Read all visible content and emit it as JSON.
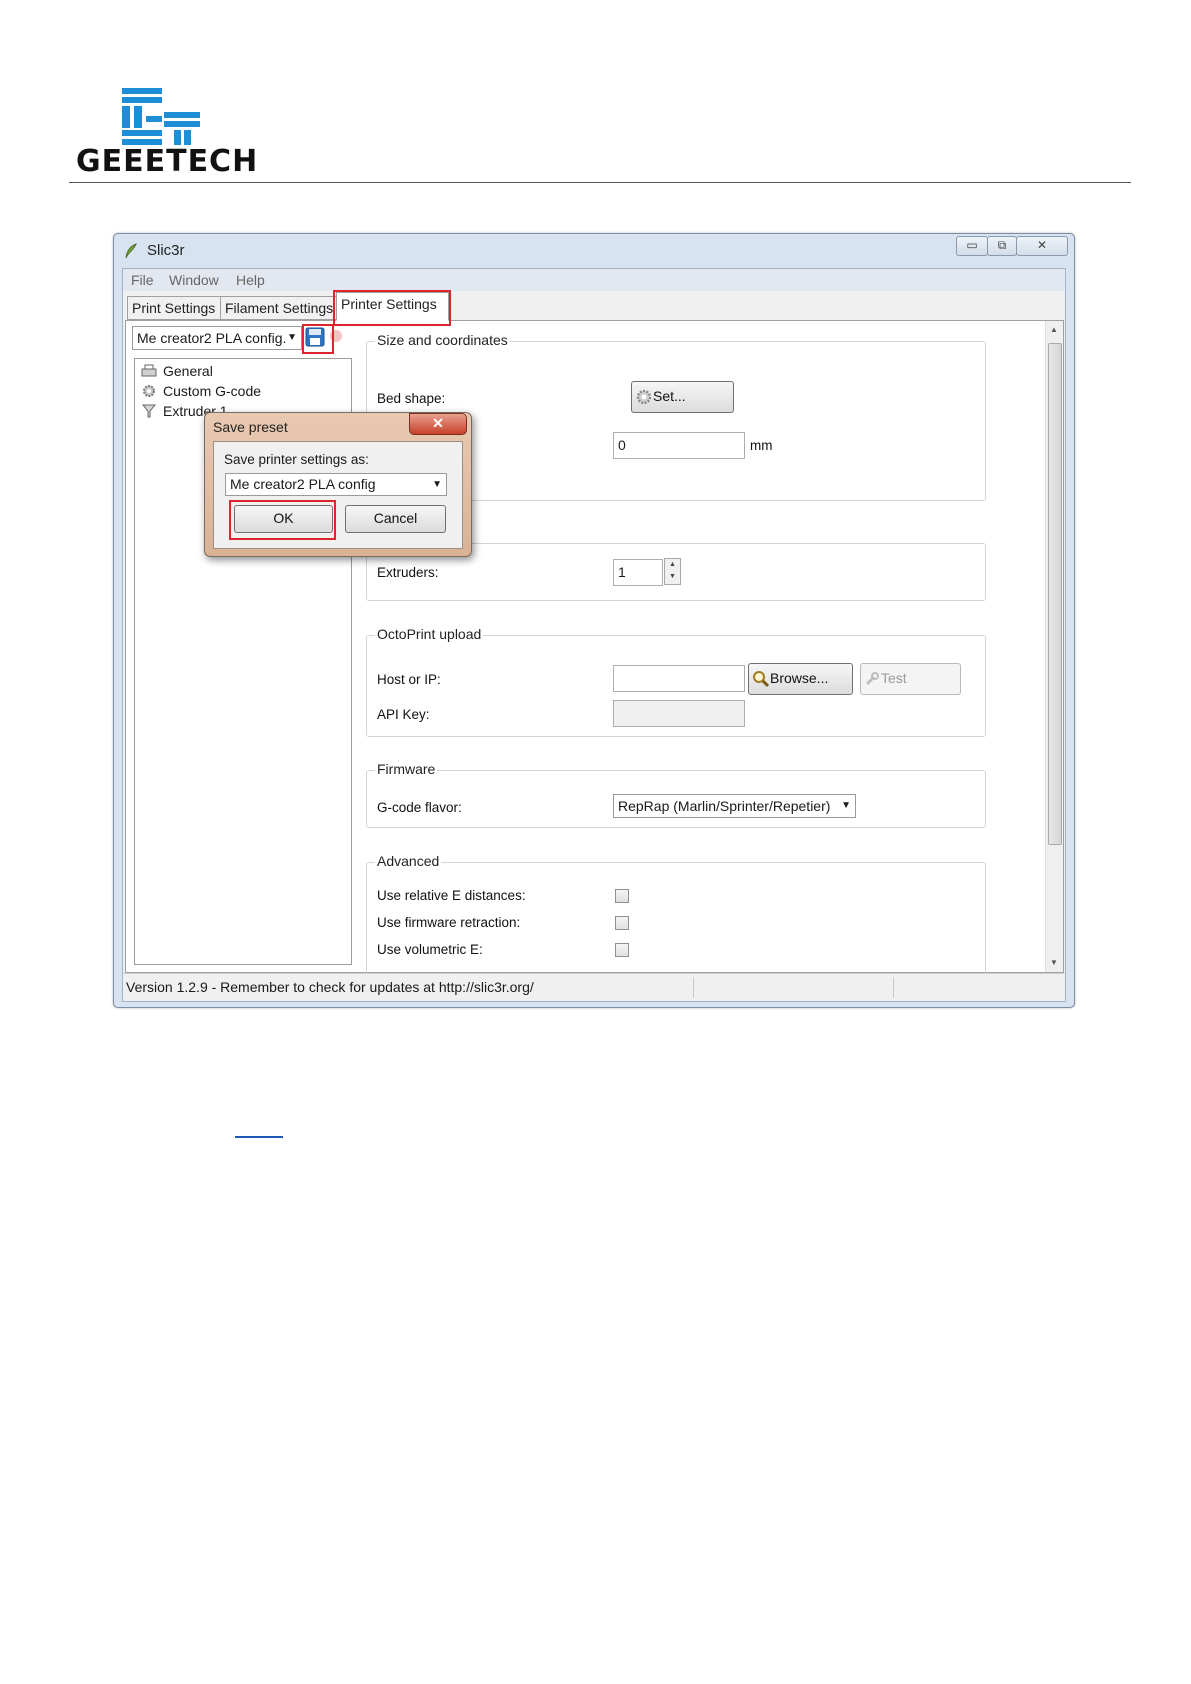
{
  "document": {
    "logo_text": "GEEETECH",
    "link_text": ""
  },
  "window": {
    "title": "Slic3r",
    "controls": {
      "minimize": "▭",
      "maximize": "⧉",
      "close": "✕"
    },
    "menu": [
      "File",
      "Window",
      "Help"
    ],
    "tabs": [
      "Print Settings",
      "Filament Settings",
      "Printer Settings"
    ],
    "active_tab": "Printer Settings",
    "preset_combo": "Me creator2 PLA config.",
    "tree": [
      "General",
      "Custom G-code",
      "Extruder 1"
    ],
    "sections": {
      "size": {
        "title": "Size and coordinates",
        "bed_shape_label": "Bed shape:",
        "set_button": "Set...",
        "z_offset_value": "0",
        "z_offset_unit": "mm"
      },
      "capabilities": {
        "extruders_label": "Extruders:",
        "extruders_value": "1"
      },
      "octoprint": {
        "title": "OctoPrint upload",
        "host_label": "Host or IP:",
        "host_value": "",
        "browse_button": "Browse...",
        "test_button": "Test",
        "api_label": "API Key:",
        "api_value": ""
      },
      "firmware": {
        "title": "Firmware",
        "flavor_label": "G-code flavor:",
        "flavor_value": "RepRap (Marlin/Sprinter/Repetier)"
      },
      "advanced": {
        "title": "Advanced",
        "options": [
          "Use relative E distances:",
          "Use firmware retraction:",
          "Use volumetric E:"
        ],
        "checked": [
          false,
          false,
          false
        ]
      }
    },
    "status_text": "Version 1.2.9 - Remember to check for updates at http://slic3r.org/"
  },
  "dialog": {
    "title": "Save preset",
    "close_glyph": "✕",
    "prompt": "Save printer settings as:",
    "name_value": "Me creator2 PLA config",
    "ok_button": "OK",
    "cancel_button": "Cancel"
  },
  "colors": {
    "highlight": "#e0242b",
    "logo_blue": "#1e8fd6"
  }
}
